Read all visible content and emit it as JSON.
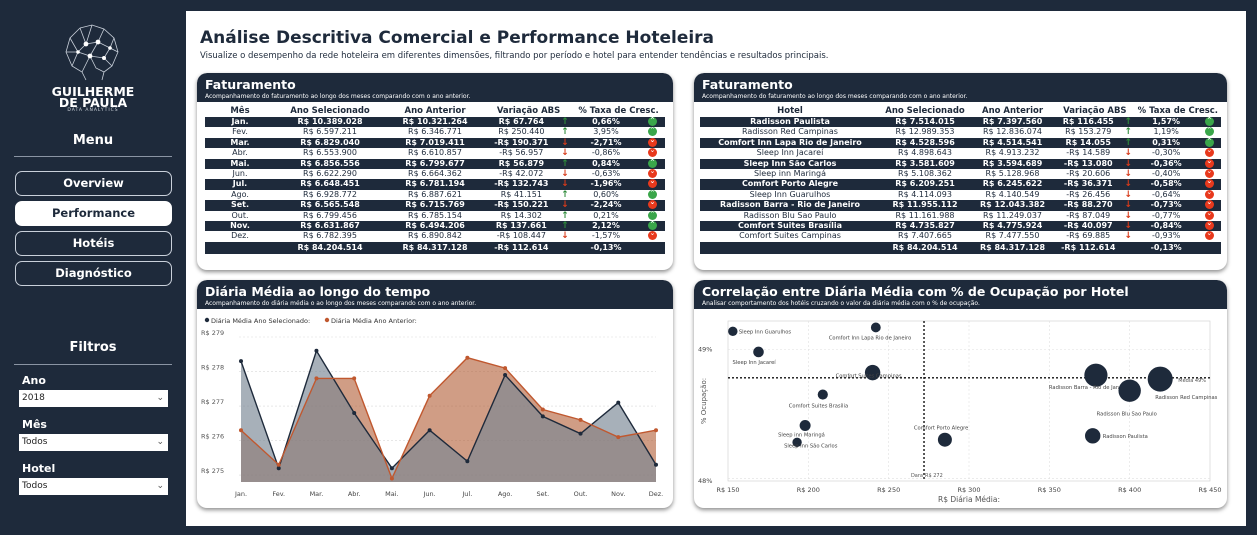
{
  "logo": {
    "line1": "GUILHERME",
    "line2": "DE PAULA",
    "sub": "DATA ANALYTICS"
  },
  "menu": {
    "title": "Menu",
    "items": [
      {
        "label": "Overview",
        "active": false
      },
      {
        "label": "Performance",
        "active": true
      },
      {
        "label": "Hotéis",
        "active": false
      },
      {
        "label": "Diagnóstico",
        "active": false
      }
    ]
  },
  "filters": {
    "title": "Filtros",
    "ano": {
      "label": "Ano",
      "value": "2018"
    },
    "mes": {
      "label": "Mês",
      "value": "Todos"
    },
    "hotel": {
      "label": "Hotel",
      "value": "Todos"
    }
  },
  "page": {
    "title": "Análise Descritiva Comercial e Performance Hoteleira",
    "subtitle": "Visualize o desempenho da rede hoteleira em diferentes dimensões, filtrando por período e hotel para entender tendências e resultados principais."
  },
  "fat_mes": {
    "title": "Faturamento",
    "subtitle": "Acompanhamento do faturamento ao longo dos meses comparando com o ano anterior.",
    "headers": [
      "Mês",
      "Ano Selecionado",
      "Ano Anterior",
      "Variação ABS",
      "% Taxa de Cresc."
    ],
    "rows": [
      [
        "Jan.",
        "R$ 10.389.028",
        "R$ 10.321.264",
        "R$ 67.764",
        "up",
        "0,66%",
        "g"
      ],
      [
        "Fev.",
        "R$ 6.597.211",
        "R$ 6.346.771",
        "R$ 250.440",
        "up",
        "3,95%",
        "g"
      ],
      [
        "Mar.",
        "R$ 6.829.040",
        "R$ 7.019.411",
        "-R$ 190.371",
        "down",
        "-2,71%",
        "r"
      ],
      [
        "Abr.",
        "R$ 6.553.900",
        "R$ 6.610.857",
        "-R$ 56.957",
        "down",
        "-0,86%",
        "r"
      ],
      [
        "Mai.",
        "R$ 6.856.556",
        "R$ 6.799.677",
        "R$ 56.879",
        "up",
        "0,84%",
        "g"
      ],
      [
        "Jun.",
        "R$ 6.622.290",
        "R$ 6.664.362",
        "-R$ 42.072",
        "down",
        "-0,63%",
        "r"
      ],
      [
        "Jul.",
        "R$ 6.648.451",
        "R$ 6.781.194",
        "-R$ 132.743",
        "down",
        "-1,96%",
        "r"
      ],
      [
        "Ago.",
        "R$ 6.928.772",
        "R$ 6.887.621",
        "R$ 41.151",
        "up",
        "0,60%",
        "g"
      ],
      [
        "Set.",
        "R$ 6.565.548",
        "R$ 6.715.769",
        "-R$ 150.221",
        "down",
        "-2,24%",
        "r"
      ],
      [
        "Out.",
        "R$ 6.799.456",
        "R$ 6.785.154",
        "R$ 14.302",
        "up",
        "0,21%",
        "g"
      ],
      [
        "Nov.",
        "R$ 6.631.867",
        "R$ 6.494.206",
        "R$ 137.661",
        "up",
        "2,12%",
        "g"
      ],
      [
        "Dez.",
        "R$ 6.782.395",
        "R$ 6.890.842",
        "-R$ 108.447",
        "down",
        "-1,57%",
        "r"
      ]
    ],
    "total": [
      "",
      "R$ 84.204.514",
      "R$ 84.317.128",
      "-R$ 112.614",
      "",
      "-0,13%",
      ""
    ]
  },
  "fat_hotel": {
    "title": "Faturamento",
    "subtitle": "Acompanhamento do faturamento ao longo dos meses comparando com o ano anterior.",
    "headers": [
      "Hotel",
      "Ano Selecionado",
      "Ano Anterior",
      "Variação ABS",
      "% Taxa de Cresc."
    ],
    "rows": [
      [
        "Radisson Paulista",
        "R$ 7.514.015",
        "R$ 7.397.560",
        "R$ 116.455",
        "up",
        "1,57%",
        "g"
      ],
      [
        "Radisson Red Campinas",
        "R$ 12.989.353",
        "R$ 12.836.074",
        "R$ 153.279",
        "up",
        "1,19%",
        "g"
      ],
      [
        "Comfort Inn Lapa Rio de Janeiro",
        "R$ 4.528.596",
        "R$ 4.514.541",
        "R$ 14.055",
        "up",
        "0,31%",
        "g"
      ],
      [
        "Sleep Inn Jacareí",
        "R$ 4.898.643",
        "R$ 4.913.232",
        "-R$ 14.589",
        "down",
        "-0,30%",
        "r"
      ],
      [
        "Sleep Inn São Carlos",
        "R$ 3.581.609",
        "R$ 3.594.689",
        "-R$ 13.080",
        "down",
        "-0,36%",
        "r"
      ],
      [
        "Sleep inn Maringá",
        "R$ 5.108.362",
        "R$ 5.128.968",
        "-R$ 20.606",
        "down",
        "-0,40%",
        "r"
      ],
      [
        "Comfort Porto Alegre",
        "R$ 6.209.251",
        "R$ 6.245.622",
        "-R$ 36.371",
        "down",
        "-0,58%",
        "r"
      ],
      [
        "Sleep Inn Guarulhos",
        "R$ 4.114.093",
        "R$ 4.140.549",
        "-R$ 26.456",
        "down",
        "-0,64%",
        "r"
      ],
      [
        "Radisson Barra - Rio de Janeiro",
        "R$ 11.955.112",
        "R$ 12.043.382",
        "-R$ 88.270",
        "down",
        "-0,73%",
        "r"
      ],
      [
        "Radisson Blu Sao Paulo",
        "R$ 11.161.988",
        "R$ 11.249.037",
        "-R$ 87.049",
        "down",
        "-0,77%",
        "r"
      ],
      [
        "Comfort Suites Brasília",
        "R$ 4.735.827",
        "R$ 4.775.924",
        "-R$ 40.097",
        "down",
        "-0,84%",
        "r"
      ],
      [
        "Comfort Suites Campinas",
        "R$ 7.407.665",
        "R$ 7.477.550",
        "-R$ 69.885",
        "down",
        "-0,93%",
        "r"
      ]
    ],
    "total": [
      "",
      "R$ 84.204.514",
      "R$ 84.317.128",
      "-R$ 112.614",
      "",
      "-0,13%",
      ""
    ]
  },
  "diaria": {
    "title": "Diária Média ao longo do tempo",
    "subtitle": "Acompanhamento do diária média o ao longo dos meses comparando com o ano anterior.",
    "chart_data": {
      "type": "area",
      "categories": [
        "Jan.",
        "Fev.",
        "Mar.",
        "Abr.",
        "Mai.",
        "Jun.",
        "Jul.",
        "Ago.",
        "Set.",
        "Out.",
        "Nov.",
        "Dez."
      ],
      "series": [
        {
          "name": "Diária Média Ano Selecionado:",
          "color": "#1e2a3b",
          "values": [
            278.3,
            275.2,
            278.6,
            276.8,
            275.2,
            276.3,
            275.4,
            277.9,
            276.7,
            276.2,
            277.1,
            275.3
          ]
        },
        {
          "name": "Diária Média Ano Anterior:",
          "color": "#c0582f",
          "values": [
            276.3,
            275.3,
            277.8,
            277.8,
            274.9,
            277.3,
            278.4,
            278.1,
            276.9,
            276.6,
            276.1,
            276.3
          ]
        }
      ],
      "yticks": [
        "R$ 279",
        "R$ 278",
        "R$ 277",
        "R$ 276",
        "R$ 275"
      ],
      "ylim": [
        274.8,
        279
      ],
      "grid": true
    }
  },
  "corr": {
    "title": "Correlação entre Diária Média com % de Ocupação por Hotel",
    "subtitle": "Analisar comportamento dos hotéis cruzando o valor da diária média com o % de ocupação.",
    "chart_data": {
      "type": "scatter",
      "xlabel": "R$ Diária Média:",
      "ylabel": "% Ocupação:",
      "xticks": [
        "R$ 150",
        "R$ 200",
        "R$ 250",
        "R$ 300",
        "R$ 350",
        "R$ 400",
        "R$ 450"
      ],
      "xlim": [
        150,
        450
      ],
      "yticks": [
        "49%",
        "48%"
      ],
      "ylim": [
        47.98,
        49.22
      ],
      "avg_x_label": "Dara",
      "avg_x_value": "R$ 272",
      "avg_y_label": "Média 49%",
      "points": [
        {
          "name": "Sleep Inn Guarulhos",
          "x": 153,
          "y": 49.14,
          "size": 4.7
        },
        {
          "name": "Comfort Inn Lapa Rio de Janeiro",
          "x": 242,
          "y": 49.17,
          "size": 4.9
        },
        {
          "name": "Sleep Inn Jacareí",
          "x": 169,
          "y": 48.98,
          "size": 5.3
        },
        {
          "name": "Comfort Suites Campinas",
          "x": 240,
          "y": 48.82,
          "size": 7.7
        },
        {
          "name": "Comfort Suites Brasília",
          "x": 209,
          "y": 48.65,
          "size": 5.1
        },
        {
          "name": "Sleep inn Maringá",
          "x": 198,
          "y": 48.41,
          "size": 5.5
        },
        {
          "name": "Sleep Inn São Carlos",
          "x": 193,
          "y": 48.28,
          "size": 4.7
        },
        {
          "name": "Comfort Porto Alegre",
          "x": 285,
          "y": 48.3,
          "size": 7.0
        },
        {
          "name": "Radisson Barra - Rio de Janeiro",
          "x": 379,
          "y": 48.8,
          "size": 11.6
        },
        {
          "name": "Radisson Red Campinas",
          "x": 419,
          "y": 48.77,
          "size": 12.5
        },
        {
          "name": "Radisson Blu Sao Paulo",
          "x": 400,
          "y": 48.68,
          "size": 11.2
        },
        {
          "name": "Radisson Paulista",
          "x": 377,
          "y": 48.33,
          "size": 7.7
        }
      ]
    }
  }
}
